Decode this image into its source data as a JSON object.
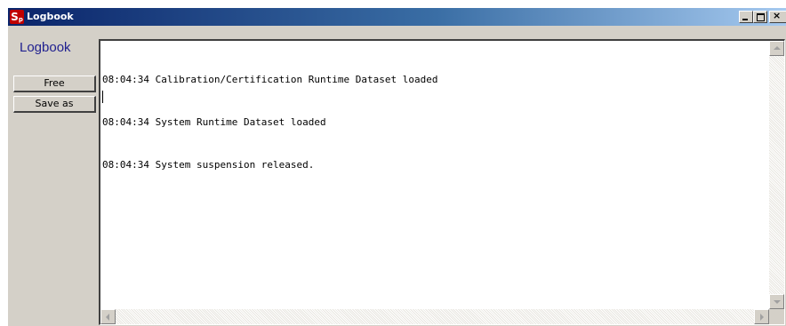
{
  "window": {
    "title": "Logbook",
    "icon": "sp-app-icon",
    "controls": {
      "minimize": "minimize-icon",
      "maximize": "maximize-icon",
      "close": "close-icon"
    }
  },
  "sidebar": {
    "label": "Logbook",
    "buttons": {
      "free_label": "Free",
      "save_as_label": "Save as"
    }
  },
  "log": {
    "lines": [
      "08:04:34 Calibration/Certification Runtime Dataset loaded",
      "08:04:34 System Runtime Dataset loaded",
      "08:04:34 System suspension released."
    ]
  },
  "colors": {
    "titlebar_start": "#0a246a",
    "titlebar_end": "#a6caf0",
    "window_face": "#d4d0c8",
    "label_text": "#1f1f8f",
    "app_icon": "#c00000"
  }
}
